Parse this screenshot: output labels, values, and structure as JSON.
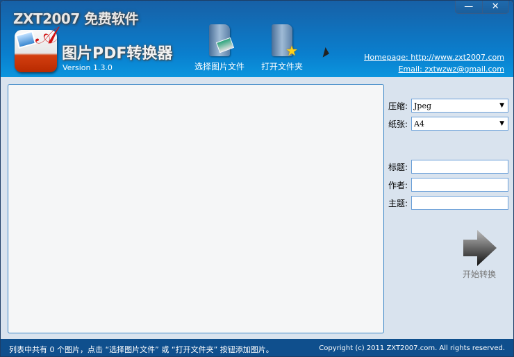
{
  "header": {
    "brand": "ZXT2007 免费软件",
    "app_title": "图片PDF转换器",
    "version": "Version 1.3.0",
    "homepage": "Homepage: http://www.zxt2007.com",
    "email": "Email: zxtwzwz@gmail.com"
  },
  "window": {
    "minimize": "—",
    "close": "✕"
  },
  "toolbar": {
    "select_images": "选择图片文件",
    "open_folder": "打开文件夹"
  },
  "options": {
    "compress_label": "压缩:",
    "compress_value": "Jpeg",
    "paper_label": "纸张:",
    "paper_value": "A4",
    "title_label": "标题:",
    "title_value": "",
    "author_label": "作者:",
    "author_value": "",
    "subject_label": "主题:",
    "subject_value": ""
  },
  "start_label": "开始转换",
  "status": {
    "message": "列表中共有 0 个图片，点击 “选择图片文件” 或 “打开文件夹” 按钮添加图片。",
    "copyright": "Copyright (c) 2011 ZXT2007.com. All rights reserved."
  }
}
